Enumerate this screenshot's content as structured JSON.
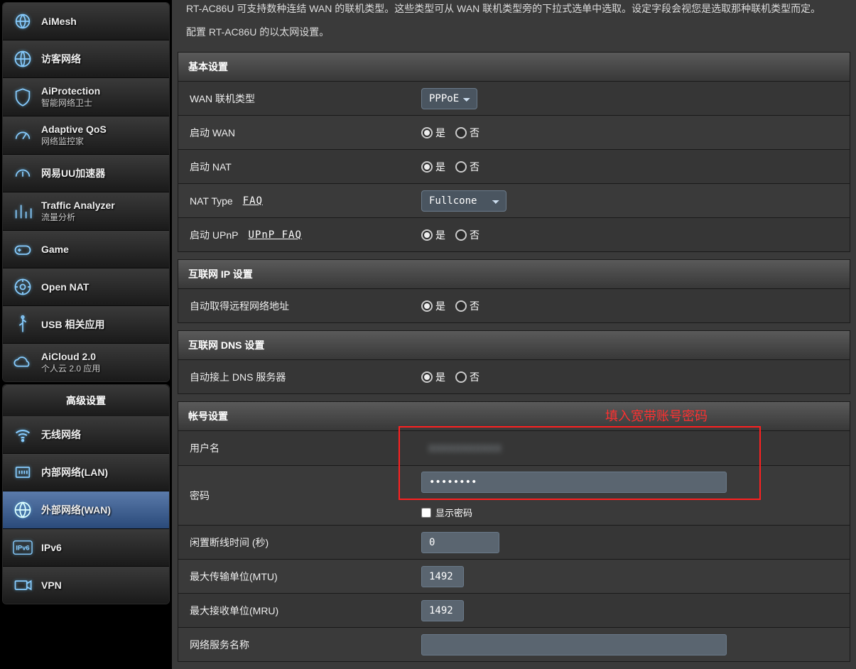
{
  "sidebar": {
    "primary": [
      {
        "label": "AiMesh",
        "sublabel": ""
      },
      {
        "label": "访客网络",
        "sublabel": ""
      },
      {
        "label": "AiProtection",
        "sublabel": "智能网络卫士"
      },
      {
        "label": "Adaptive QoS",
        "sublabel": "网络监控家"
      },
      {
        "label": "网易UU加速器",
        "sublabel": ""
      },
      {
        "label": "Traffic Analyzer",
        "sublabel": "流量分析"
      },
      {
        "label": "Game",
        "sublabel": ""
      },
      {
        "label": "Open NAT",
        "sublabel": ""
      },
      {
        "label": "USB 相关应用",
        "sublabel": ""
      },
      {
        "label": "AiCloud 2.0",
        "sublabel": "个人云 2.0 应用"
      }
    ],
    "advanced_header": "高级设置",
    "advanced": [
      {
        "label": "无线网络"
      },
      {
        "label": "内部网络(LAN)"
      },
      {
        "label": "外部网络(WAN)"
      },
      {
        "label": "IPv6"
      },
      {
        "label": "VPN"
      }
    ]
  },
  "main": {
    "intro_partial": "RT-AC86U 可支持数种连结 WAN 的联机类型。这些类型可从 WAN 联机类型旁的下拉式选单中选取。设定字段会视您是选取那种联机类型而定。",
    "intro_sub": "配置 RT-AC86U 的以太网设置。",
    "annotation": "填入宽带账号密码",
    "radio": {
      "yes": "是",
      "no": "否"
    },
    "sections": {
      "basic": {
        "title": "基本设置",
        "conn_type_label": "WAN 联机类型",
        "conn_type_value": "PPPoE",
        "enable_wan": "启动 WAN",
        "enable_nat": "启动 NAT",
        "nat_type_label": "NAT Type",
        "nat_type_faq": "FAQ",
        "nat_type_value": "Fullcone",
        "enable_upnp": "启动 UPnP",
        "upnp_faq": "UPnP FAQ"
      },
      "ip": {
        "title": "互联网 IP 设置",
        "auto_ip": "自动取得远程网络地址"
      },
      "dns": {
        "title": "互联网 DNS 设置",
        "auto_dns": "自动接上 DNS 服务器"
      },
      "account": {
        "title": "帐号设置",
        "user_label": "用户名",
        "user_value": "XXXXXXXXXXX",
        "pass_label": "密码",
        "pass_value": "••••••••",
        "show_pass": "显示密码",
        "idle_label": "闲置断线时间 (秒)",
        "idle_value": "0",
        "mtu_label": "最大传输单位(MTU)",
        "mtu_value": "1492",
        "mru_label": "最大接收单位(MRU)",
        "mru_value": "1492",
        "service_label": "网络服务名称",
        "service_value": ""
      }
    }
  }
}
